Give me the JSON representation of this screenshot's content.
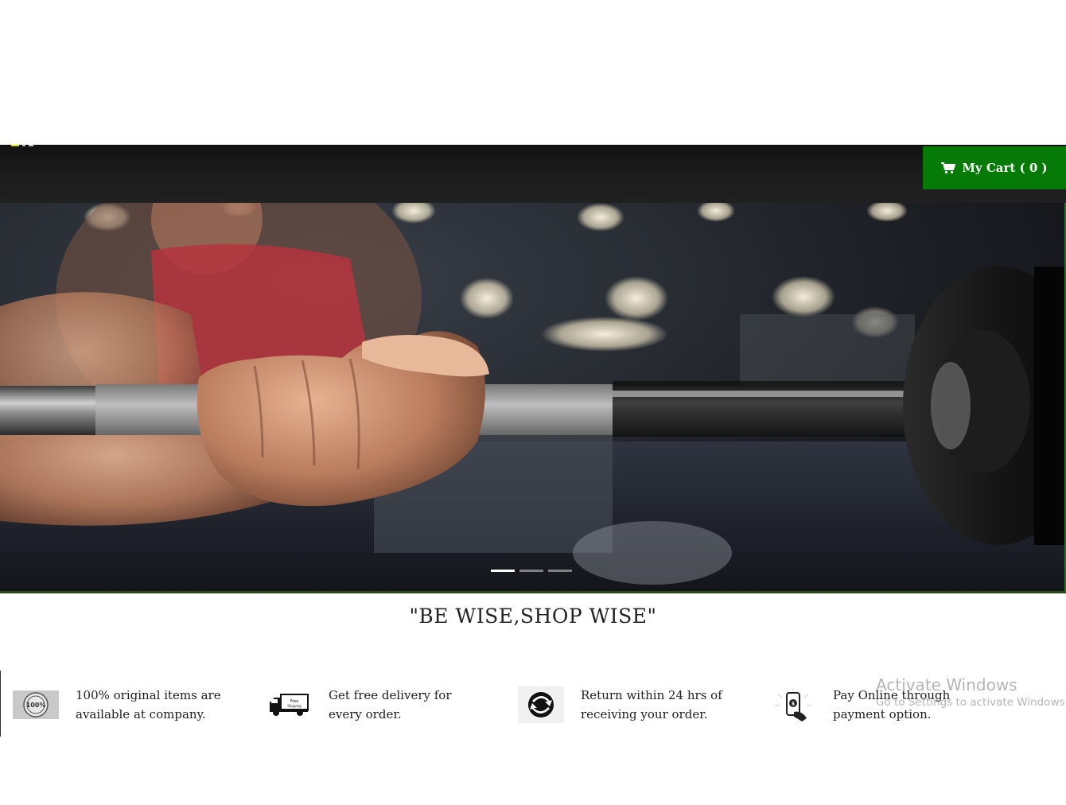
{
  "header": {
    "cart_label": "My Cart ( 0 )",
    "cart_icon": "shopping-cart-icon",
    "cart_color": "#067a06"
  },
  "hero": {
    "image_subject": "gym-barbell-grip-photo",
    "slide_count": 3,
    "active_slide": 1
  },
  "tagline": "\"BE WISE,SHOP WISE\"",
  "features": [
    {
      "icon": "quality-seal-icon",
      "line1": "100% original items are",
      "line2": "available at company."
    },
    {
      "icon": "delivery-truck-icon",
      "line1": "Get free delivery for",
      "line2": "every order."
    },
    {
      "icon": "return-arrows-icon",
      "line1": "Return within 24 hrs of",
      "line2": "receiving your order."
    },
    {
      "icon": "mobile-payment-icon",
      "line1": "Pay Online through",
      "line2": "payment option."
    }
  ],
  "watermark": {
    "title": "Activate Windows",
    "subtitle": "Go to Settings to activate Windows."
  }
}
